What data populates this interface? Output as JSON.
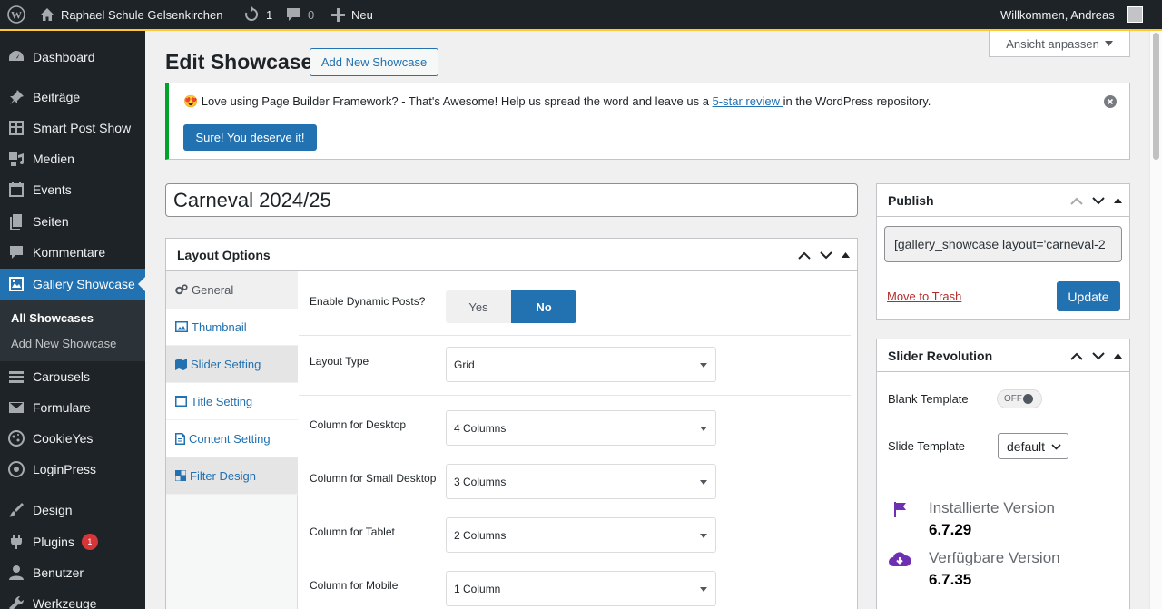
{
  "adminbar": {
    "site_name": "Raphael Schule Gelsenkirchen",
    "updates_count": "1",
    "comments_count": "0",
    "new_label": "Neu",
    "greeting": "Willkommen, Andreas"
  },
  "sidebar": {
    "items": [
      {
        "label": "Dashboard",
        "icon": "dashboard-icon"
      },
      {
        "label": "Beiträge",
        "icon": "pin-icon"
      },
      {
        "label": "Smart Post Show",
        "icon": "grid-icon"
      },
      {
        "label": "Medien",
        "icon": "media-icon"
      },
      {
        "label": "Events",
        "icon": "calendar-icon"
      },
      {
        "label": "Seiten",
        "icon": "pages-icon"
      },
      {
        "label": "Kommentare",
        "icon": "comment-icon"
      },
      {
        "label": "Gallery Showcase",
        "icon": "gallery-icon"
      },
      {
        "label": "Carousels",
        "icon": "carousel-icon"
      },
      {
        "label": "Formulare",
        "icon": "mail-icon"
      },
      {
        "label": "CookieYes",
        "icon": "cookie-icon"
      },
      {
        "label": "LoginPress",
        "icon": "loginpress-icon"
      },
      {
        "label": "Design",
        "icon": "brush-icon"
      },
      {
        "label": "Plugins",
        "icon": "plugin-icon",
        "badge": "1"
      },
      {
        "label": "Benutzer",
        "icon": "user-icon"
      },
      {
        "label": "Werkzeuge",
        "icon": "wrench-icon"
      }
    ],
    "submenu": [
      "All Showcases",
      "Add New Showcase"
    ]
  },
  "screen_options": "Ansicht anpassen",
  "header": {
    "title": "Edit Showcase",
    "add_new": "Add New Showcase"
  },
  "notice": {
    "text_before": "😍 Love using Page Builder Framework? - That's Awesome! Help us spread the word and leave us a ",
    "link": "5-star review ",
    "text_after": "in the WordPress repository.",
    "button": "Sure! You deserve it!"
  },
  "post_title": "Carneval 2024/25",
  "layout_box": {
    "title": "Layout Options",
    "tabs": [
      "General",
      "Thumbnail",
      "Slider Setting",
      "Title Setting",
      "Content Setting",
      "Filter Design"
    ],
    "dynamic_posts_label": "Enable Dynamic Posts?",
    "yes": "Yes",
    "no": "No",
    "layout_type_label": "Layout Type",
    "layout_type_value": "Grid",
    "col_desktop_label": "Column for Desktop",
    "col_desktop_value": "4 Columns",
    "col_small_label": "Column for Small Desktop",
    "col_small_value": "3 Columns",
    "col_tablet_label": "Column for Tablet",
    "col_tablet_value": "2 Columns",
    "col_mobile_label": "Column for Mobile",
    "col_mobile_value": "1 Column"
  },
  "publish": {
    "title": "Publish",
    "shortcode": "[gallery_showcase layout='carneval-2",
    "trash": "Move to Trash",
    "update": "Update"
  },
  "slider_revolution": {
    "title": "Slider Revolution",
    "blank_template_label": "Blank Template",
    "blank_template_value": "OFF",
    "slide_template_label": "Slide Template",
    "slide_template_value": "default",
    "installed_label": "Installierte Version",
    "installed_version": "6.7.29",
    "available_label": "Verfügbare Version",
    "available_version": "6.7.35"
  },
  "colors": {
    "primary": "#2271b1",
    "admin_bg": "#1d2327",
    "notice_green": "#00a32a",
    "accent_purple": "#6f2fb3",
    "badge_red": "#d63638"
  }
}
